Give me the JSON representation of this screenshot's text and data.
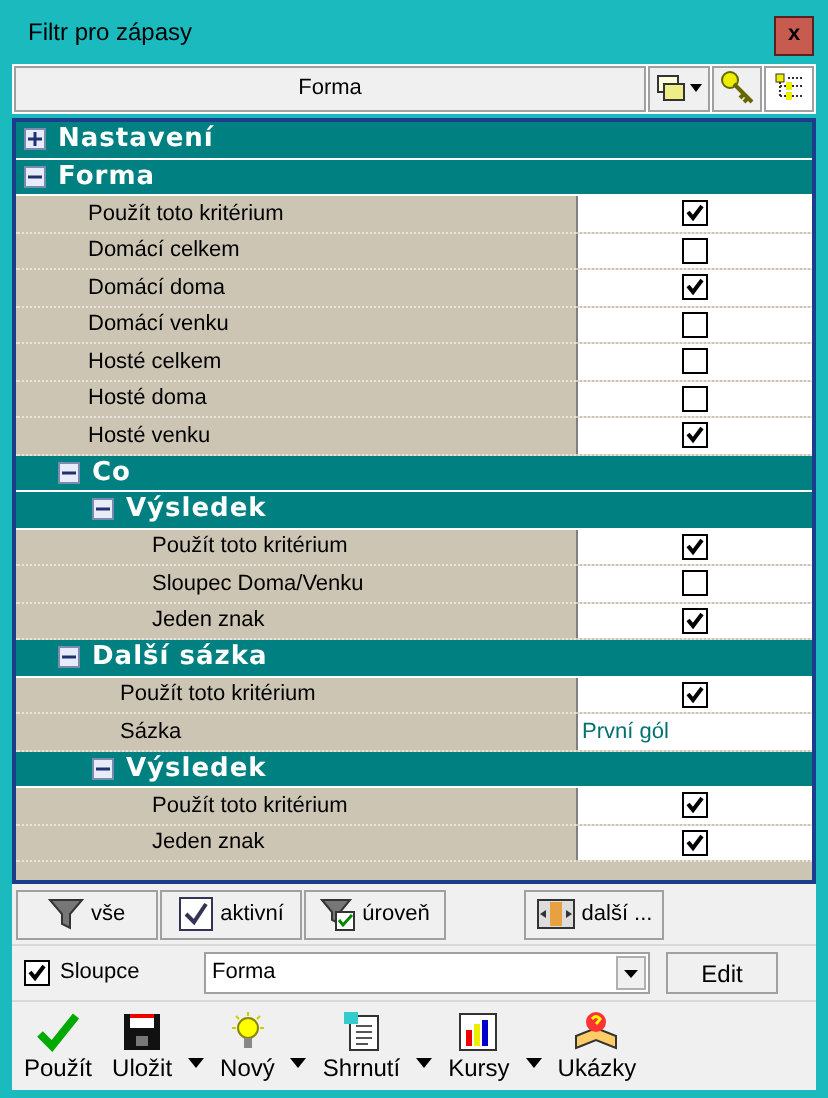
{
  "window": {
    "title": "Filtr pro zápasy",
    "close": "x"
  },
  "header": {
    "title": "Forma"
  },
  "tree": [
    {
      "kind": "section",
      "label": "Nastavení",
      "expanded": false
    },
    {
      "kind": "section",
      "label": "Forma",
      "expanded": true,
      "children": [
        {
          "kind": "checkbox",
          "label": "Použít toto kritérium",
          "checked": true
        },
        {
          "kind": "checkbox",
          "label": "Domácí celkem",
          "checked": false
        },
        {
          "kind": "checkbox",
          "label": "Domácí doma",
          "checked": true
        },
        {
          "kind": "checkbox",
          "label": "Domácí venku",
          "checked": false
        },
        {
          "kind": "checkbox",
          "label": "Hosté celkem",
          "checked": false
        },
        {
          "kind": "checkbox",
          "label": "Hosté doma",
          "checked": false
        },
        {
          "kind": "checkbox",
          "label": "Hosté venku",
          "checked": true
        },
        {
          "kind": "section",
          "label": "Co",
          "expanded": true,
          "children": [
            {
              "kind": "section",
              "label": "Výsledek",
              "expanded": true,
              "children": [
                {
                  "kind": "checkbox",
                  "label": "Použít toto kritérium",
                  "checked": true
                },
                {
                  "kind": "checkbox",
                  "label": "Sloupec Doma/Venku",
                  "checked": false
                },
                {
                  "kind": "checkbox",
                  "label": "Jeden znak",
                  "checked": true
                }
              ]
            }
          ]
        },
        {
          "kind": "section",
          "label": "Další sázka",
          "expanded": true,
          "children": [
            {
              "kind": "checkbox",
              "label": "Použít toto kritérium",
              "checked": true
            },
            {
              "kind": "value",
              "label": "Sázka",
              "value": "První gól"
            },
            {
              "kind": "section",
              "label": "Výsledek",
              "expanded": true,
              "children": [
                {
                  "kind": "checkbox",
                  "label": "Použít toto kritérium",
                  "checked": true
                },
                {
                  "kind": "checkbox",
                  "label": "Jeden znak",
                  "checked": true
                }
              ]
            }
          ]
        }
      ]
    }
  ],
  "filter_buttons": [
    "vše",
    "aktivní",
    "úroveň",
    "další ..."
  ],
  "columns": {
    "label": "Sloupce",
    "checked": true,
    "value": "Forma",
    "edit": "Edit"
  },
  "toolbar": [
    {
      "label": "Použít",
      "menu": false
    },
    {
      "label": "Uložit",
      "menu": true
    },
    {
      "label": "Nový",
      "menu": true
    },
    {
      "label": "Shrnutí",
      "menu": true
    },
    {
      "label": "Kursy",
      "menu": true
    },
    {
      "label": "Ukázky",
      "menu": false
    }
  ]
}
